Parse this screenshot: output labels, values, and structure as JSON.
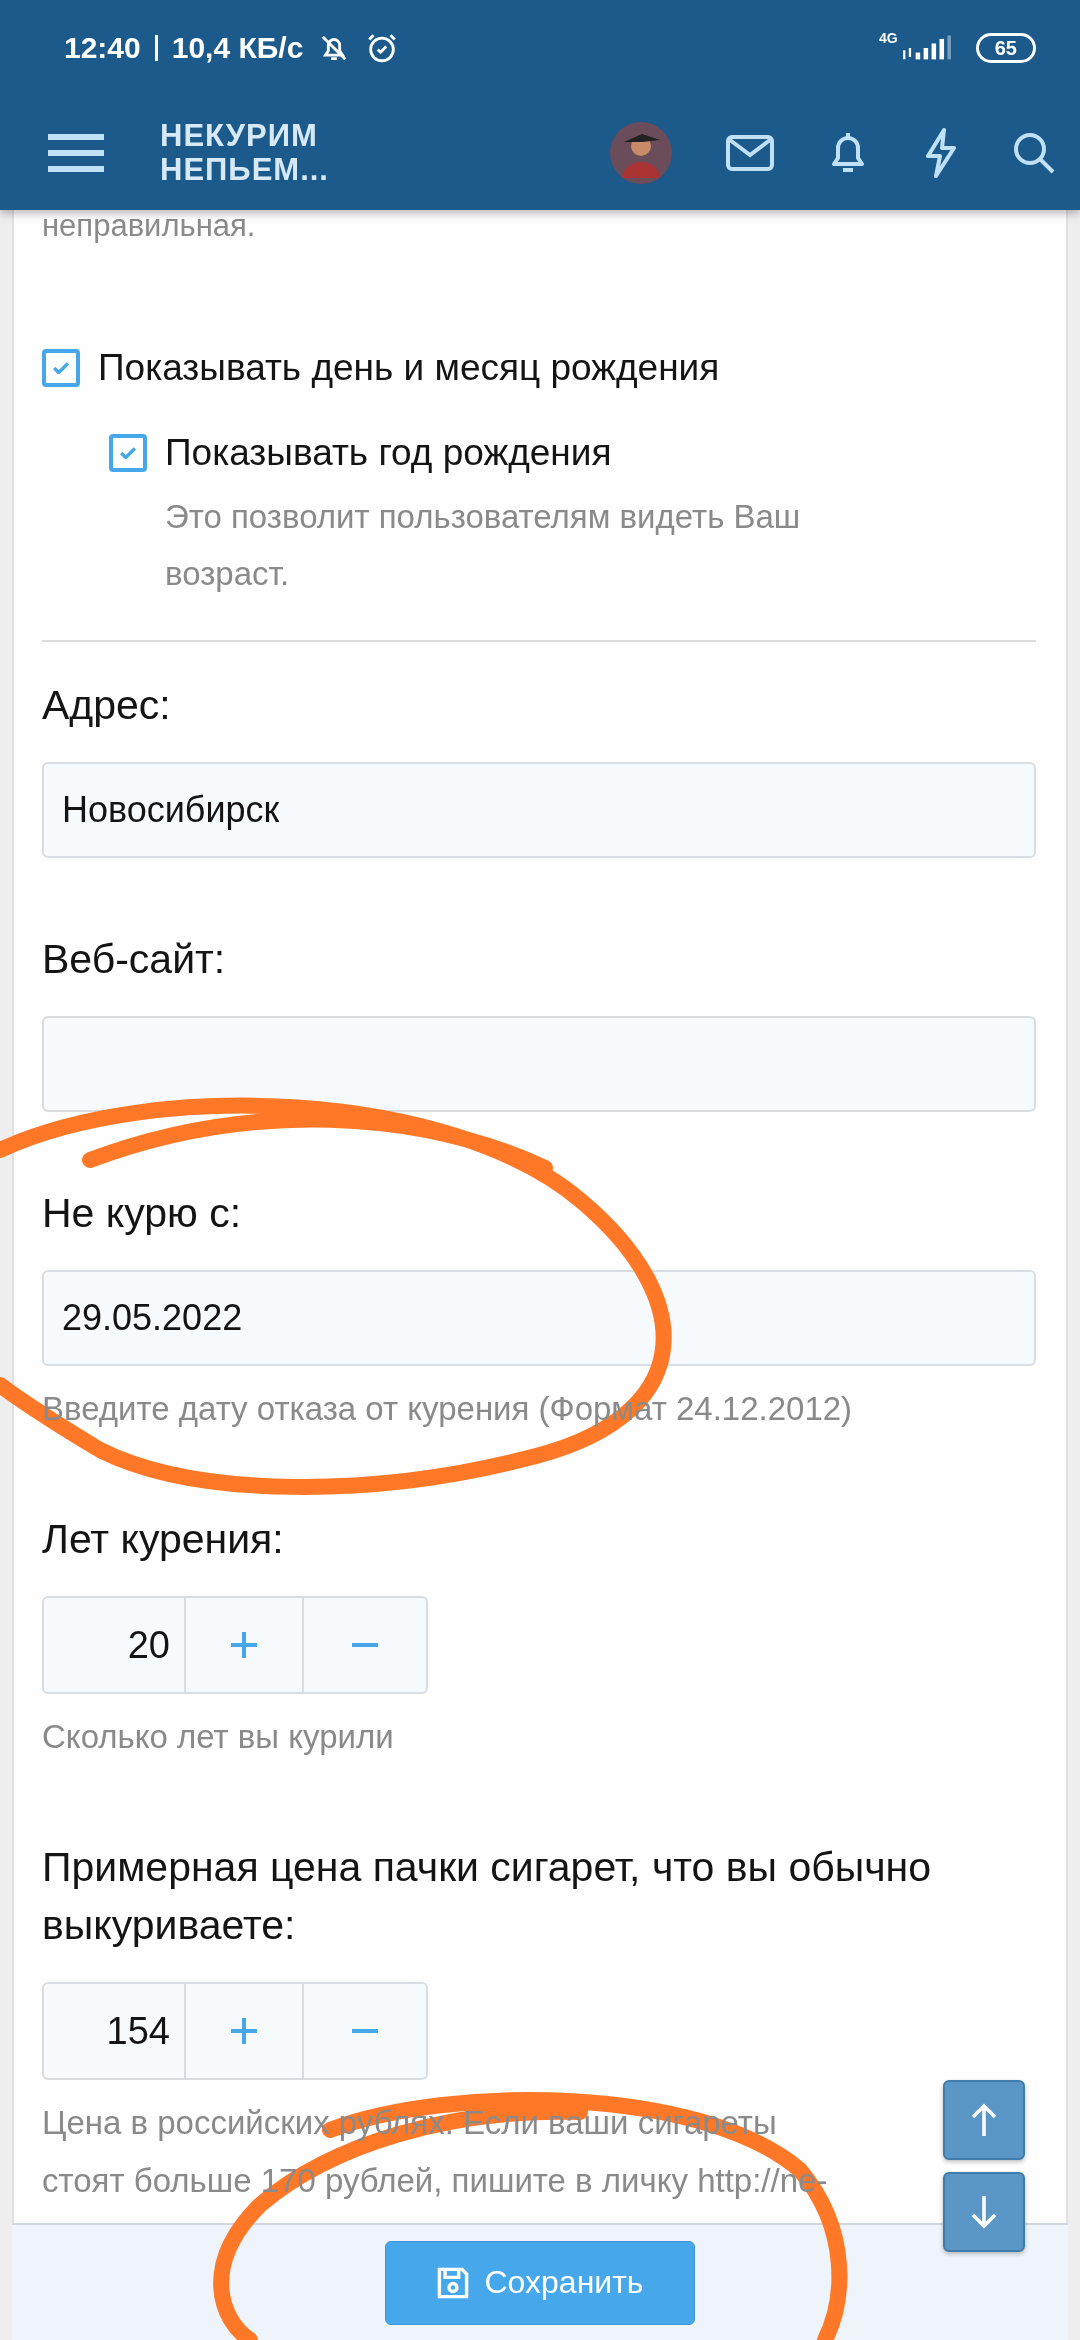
{
  "status_bar": {
    "time": "12:40",
    "speed": "10,4 КБ/с",
    "network": "4G",
    "battery": "65"
  },
  "header": {
    "title": "НЕКУРИМ НЕПЬЕМ..."
  },
  "form": {
    "top_text": "неправильная.",
    "checkboxes": [
      {
        "label": "Показывать день и месяц рождения",
        "checked": true,
        "children": [
          {
            "label": "Показывать год рождения",
            "checked": true,
            "hint": "Это позволит пользователям видеть Ваш возраст."
          }
        ]
      }
    ],
    "fields": [
      {
        "kind": "text",
        "label": "Адрес:",
        "value": "Новосибирск"
      },
      {
        "kind": "text",
        "label": "Веб-сайт:"
      },
      {
        "kind": "text",
        "label": "Не курю с:",
        "value": "29.05.2022",
        "hint": "Введите дату отказа от курения (Формат 24.12.2012)"
      },
      {
        "kind": "number",
        "label": "Лет курения:",
        "value": "20",
        "hint": "Сколько лет вы курили"
      },
      {
        "kind": "number",
        "label": "Примерная цена пачки сигарет, что вы обычно выкуриваете:",
        "value": "154",
        "hint": "Цена в российских рублях. Если ваши сигареты стоят больше 170 рублей, пишите в личку http://ne-"
      }
    ]
  },
  "footer": {
    "save_button": "Сохранить"
  }
}
